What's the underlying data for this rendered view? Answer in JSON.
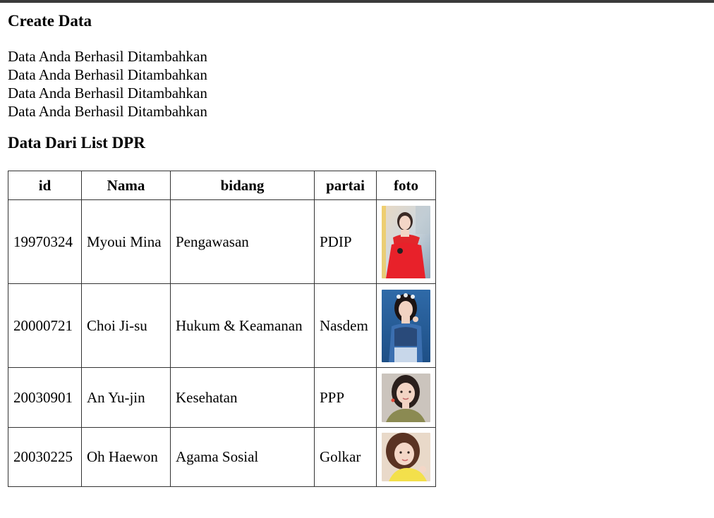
{
  "page": {
    "title": "Create Data",
    "messages": [
      "Data Anda Berhasil Ditambahkan",
      "Data Anda Berhasil Ditambahkan",
      "Data Anda Berhasil Ditambahkan",
      "Data Anda Berhasil Ditambahkan"
    ],
    "list_title": "Data Dari List DPR"
  },
  "table": {
    "headers": [
      "id",
      "Nama",
      "bidang",
      "partai",
      "foto"
    ],
    "rows": [
      {
        "id": "19970324",
        "nama": "Myoui Mina",
        "bidang": "Pengawasan",
        "partai": "PDIP",
        "foto": "photo-red-dress"
      },
      {
        "id": "20000721",
        "nama": "Choi Ji-su",
        "bidang": "Hukum & Keamanan",
        "partai": "Nasdem",
        "foto": "photo-blue-outfit"
      },
      {
        "id": "20030901",
        "nama": "An Yu-jin",
        "bidang": "Kesehatan",
        "partai": "PPP",
        "foto": "photo-olive-top"
      },
      {
        "id": "20030225",
        "nama": "Oh Haewon",
        "bidang": "Agama Sosial",
        "partai": "Golkar",
        "foto": "photo-yellow-top"
      }
    ]
  },
  "colors": {
    "border": "#333333",
    "topbar": "#3a3a3a"
  }
}
